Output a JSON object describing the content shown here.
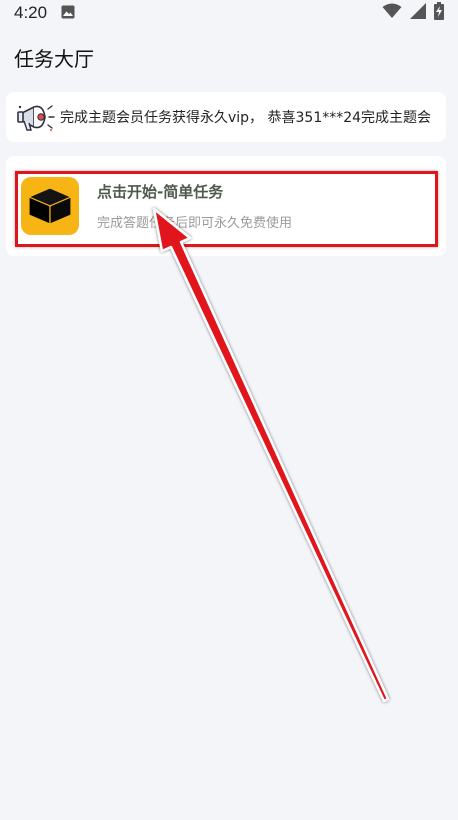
{
  "status_bar": {
    "time": "4:20",
    "icons": [
      "gallery-icon",
      "wifi-icon",
      "signal-icon",
      "battery-charging-icon"
    ]
  },
  "header": {
    "title": "任务大厅"
  },
  "notice": {
    "icon": "megaphone-icon",
    "text": "完成主题会员任务获得永久vip， 恭喜351***24完成主题会"
  },
  "tasks": [
    {
      "icon": "cube-icon",
      "title": "点击开始-简单任务",
      "subtitle": "完成答题任务后即可永久免费使用"
    }
  ],
  "colors": {
    "background": "#f4f5f9",
    "card": "#ffffff",
    "task_icon_bg": "#f7b515",
    "highlight": "#e0141b",
    "title_text": "#4d5a4a",
    "subtitle_text": "#9a9a9a"
  }
}
